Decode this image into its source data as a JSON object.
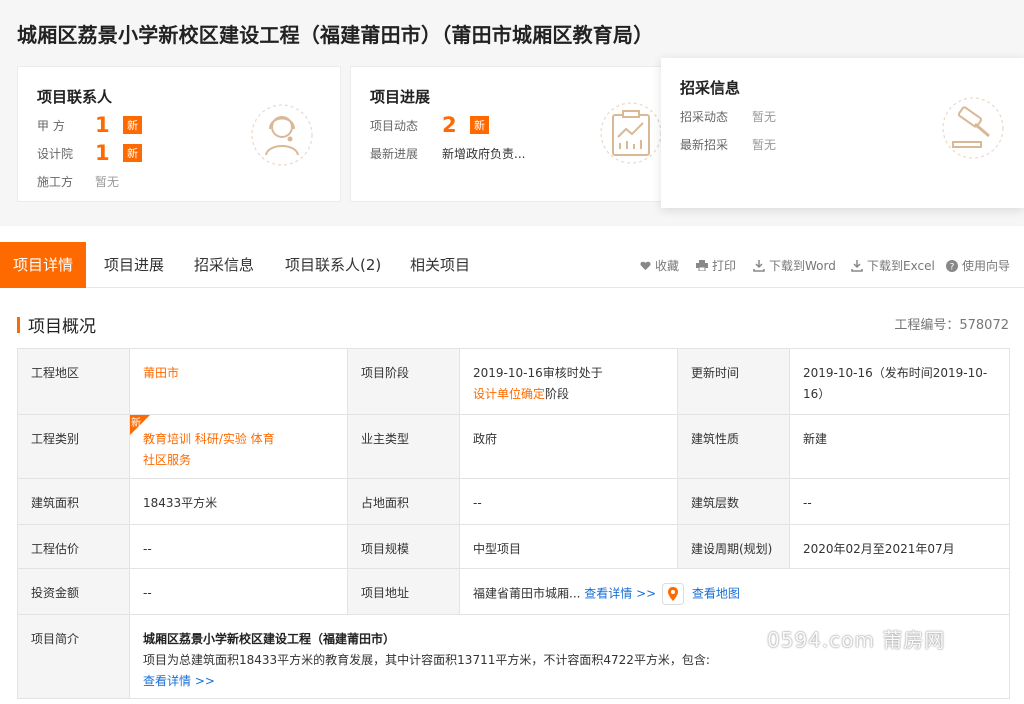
{
  "page_title": "城厢区荔景小学新校区建设工程（福建莆田市）（莆田市城厢区教育局）",
  "cards": {
    "contacts": {
      "title": "项目联系人",
      "rows": [
        {
          "label": "甲 方",
          "count": "1",
          "tag": "新"
        },
        {
          "label": "设计院",
          "count": "1",
          "tag": "新"
        },
        {
          "label": "施工方",
          "value": "暂无"
        }
      ],
      "icon": "customer-service-icon"
    },
    "progress": {
      "title": "项目进展",
      "rows": [
        {
          "label": "项目动态",
          "count": "2",
          "tag": "新"
        },
        {
          "label": "最新进展",
          "value": "新增政府负责..."
        }
      ],
      "icon": "chart-board-icon"
    },
    "procurement": {
      "title": "招采信息",
      "rows": [
        {
          "label": "招采动态",
          "value": "暂无"
        },
        {
          "label": "最新招采",
          "value": "暂无"
        }
      ],
      "icon": "gavel-icon"
    }
  },
  "tabs": [
    "项目详情",
    "项目进展",
    "招采信息",
    "项目联系人(2)",
    "相关项目"
  ],
  "tools": [
    {
      "label": "收藏",
      "icon": "heart-icon"
    },
    {
      "label": "打印",
      "icon": "print-icon"
    },
    {
      "label": "下载到Word",
      "icon": "download-icon"
    },
    {
      "label": "下载到Excel",
      "icon": "download-icon"
    },
    {
      "label": "使用向导",
      "icon": "help-icon"
    }
  ],
  "section": {
    "title": "项目概况",
    "code": "工程编号：578072"
  },
  "table": {
    "r1": {
      "k1": "工程地区",
      "v1": "莆田市",
      "k2": "项目阶段",
      "v2a": "2019-10-16审核时处于",
      "v2b": "设计单位确定",
      "v2c": "阶段",
      "k3": "更新时间",
      "v3": "2019-10-16（发布时间2019-10-16）"
    },
    "r2": {
      "k1": "工程类别",
      "tag": "新",
      "v1a": "教育培训 科研/实验 体育",
      "v1b": "社区服务",
      "k2": "业主类型",
      "v2": "政府",
      "k3": "建筑性质",
      "v3": "新建"
    },
    "r3": {
      "k1": "建筑面积",
      "v1": "18433平方米",
      "k2": "占地面积",
      "v2": "--",
      "k3": "建筑层数",
      "v3": "--"
    },
    "r4": {
      "k1": "工程估价",
      "v1": "--",
      "k2": "项目规模",
      "v2": "中型项目",
      "k3": "建设周期(规划)",
      "v3": "2020年02月至2021年07月"
    },
    "r5": {
      "k1": "投资金额",
      "v1": "--",
      "k2": "项目地址",
      "v2": "福建省莆田市城厢...",
      "link1": "查看详情 >>",
      "link2": "查看地图"
    },
    "r6": {
      "k1": "项目简介",
      "title": "城厢区荔景小学新校区建设工程（福建莆田市）",
      "text": "项目为总建筑面积18433平方米的教育发展，其中计容面积13711平方米，不计容面积4722平方米，包含:",
      "link": "查看详情 >>"
    }
  },
  "watermark": "0594.com 莆房网",
  "colors": {
    "accent": "#ff6a00",
    "link": "#1a6fd4"
  }
}
